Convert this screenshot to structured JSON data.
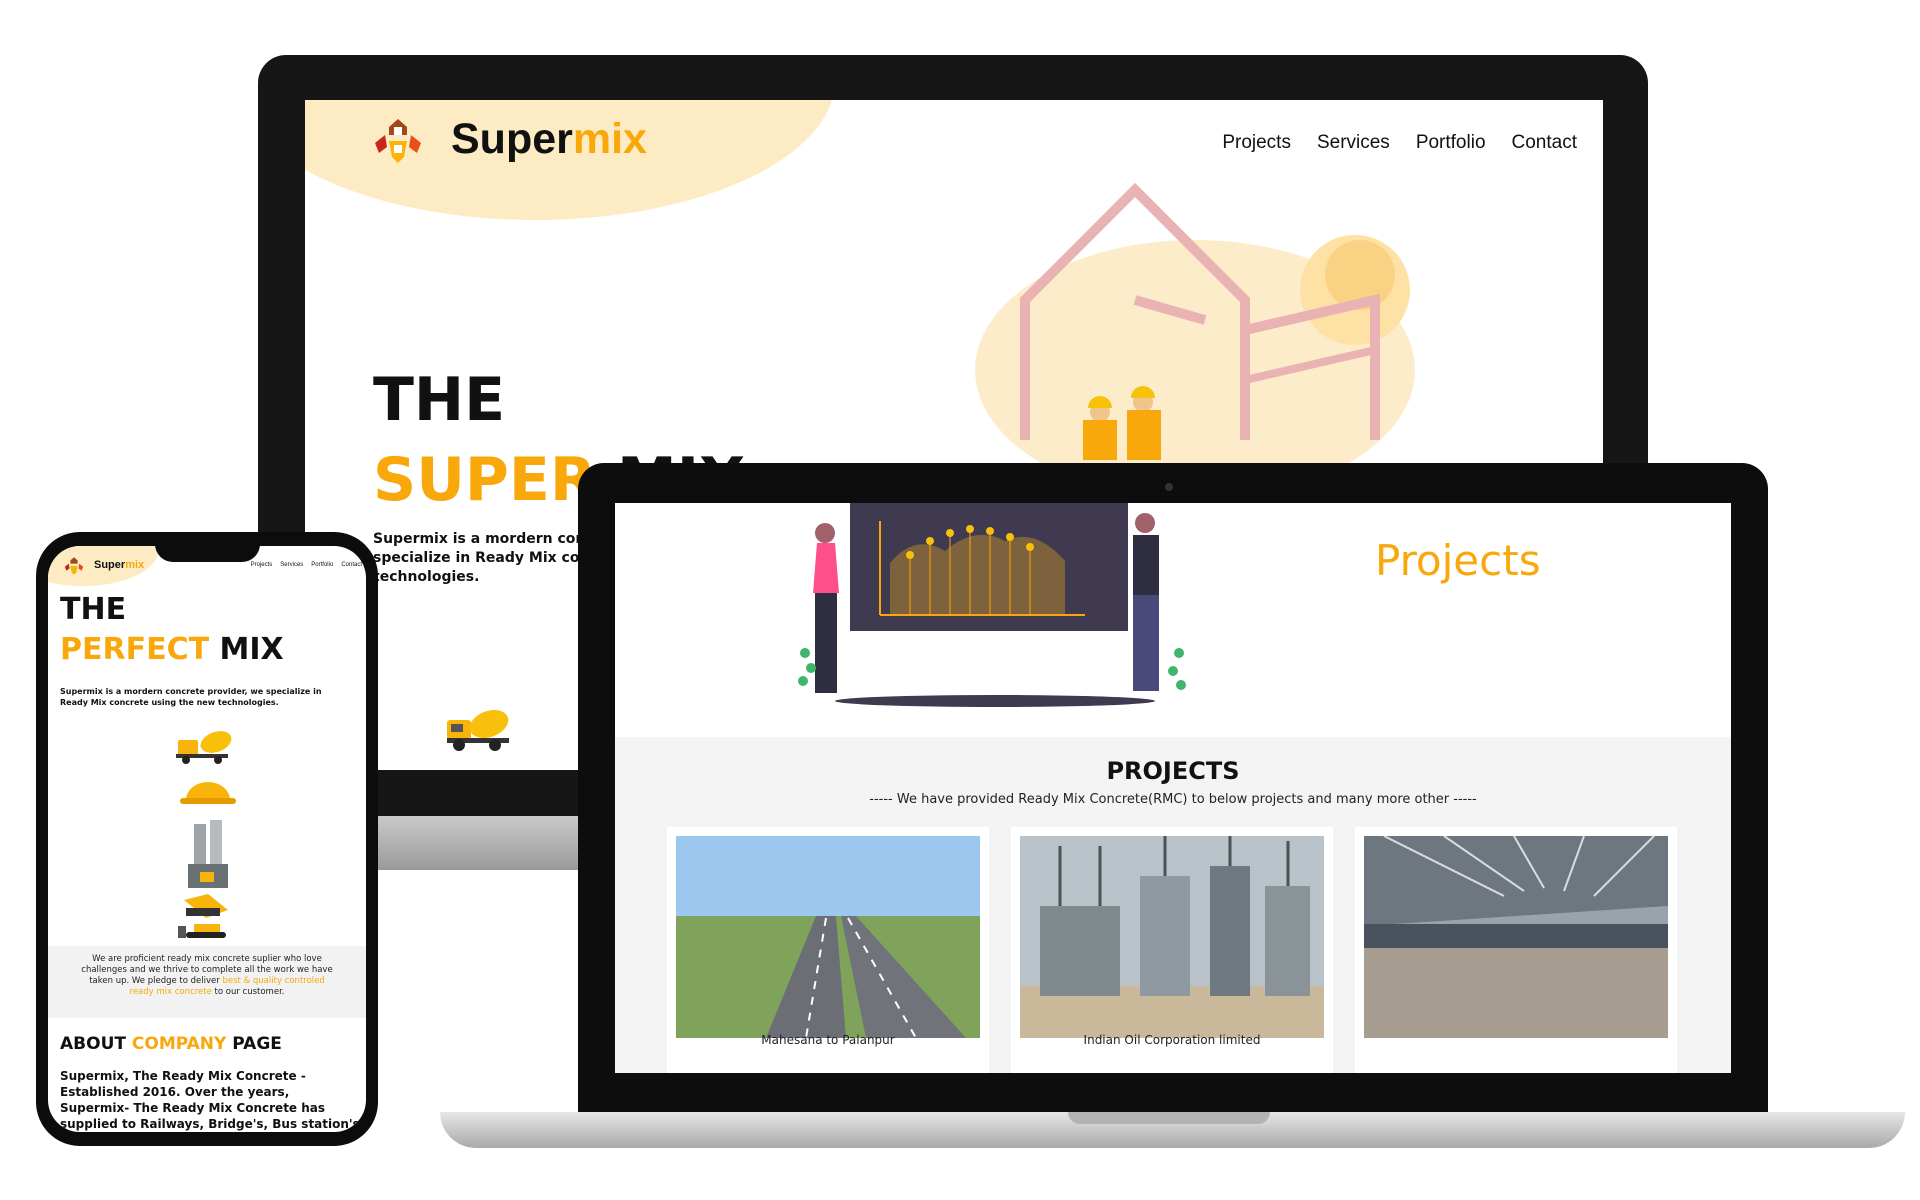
{
  "desktop": {
    "brand": {
      "main": "Super",
      "accent": "mix"
    },
    "nav": [
      "Projects",
      "Services",
      "Portfolio",
      "Contact"
    ],
    "hero": {
      "line1": "THE",
      "line2_accent": "SUPER",
      "line2_rest": " MIX"
    },
    "description": "Supermix is a mordern concrete provider, we specialize in Ready Mix concrete using the new technologies."
  },
  "laptop": {
    "page_title": "Projects",
    "section_heading": "PROJECTS",
    "section_subtitle": "----- We have provided Ready Mix Concrete(RMC) to below projects and many more other -----",
    "projects": [
      {
        "caption": "Mahesana to Palanpur"
      },
      {
        "caption": "Indian Oil Corporation limited"
      },
      {
        "caption": ""
      }
    ]
  },
  "mobile": {
    "brand": {
      "main": "Super",
      "accent": "mix"
    },
    "nav": [
      "Projects",
      "Services",
      "Portfolio",
      "Contact"
    ],
    "hero": {
      "line1": "THE",
      "line2_accent": "PERFECT",
      "line2_rest": " MIX"
    },
    "description": "Supermix is a mordern concrete provider, we specialize in Ready Mix concrete using the new technologies.",
    "intro": {
      "before": "We are proficient ready mix concrete suplier who love challenges and we thrive to complete all the work we have taken up. We pledge to deliver ",
      "highlight": "best & quality controled ready mix concrete",
      "after": " to our customer."
    },
    "about": {
      "before": "ABOUT ",
      "accent": "COMPANY",
      "after": " PAGE"
    },
    "about_text": "Supermix, The Ready Mix Concrete - Established 2016. Over the years, Supermix- The Ready Mix Concrete has supplied to Railways, Bridge's, Bus station's and many"
  },
  "colors": {
    "accent": "#f8a80b",
    "blob": "#fdebc3",
    "device": "#111111",
    "section_bg": "#f4f4f4"
  }
}
